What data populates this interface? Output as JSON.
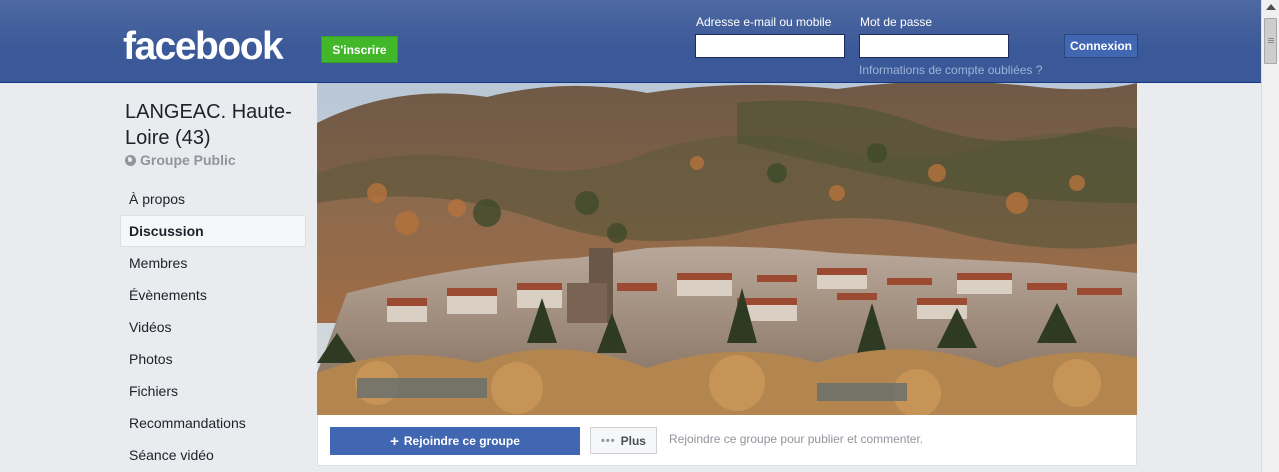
{
  "header": {
    "logo": "facebook",
    "signup_label": "S'inscrire",
    "email_label": "Adresse e-mail ou mobile",
    "password_label": "Mot de passe",
    "login_label": "Connexion",
    "forgot_label": "Informations de compte oubliées ?"
  },
  "group": {
    "title": "LANGEAC. Haute-Loire (43)",
    "type": "Groupe Public"
  },
  "sidebar": {
    "items": [
      {
        "label": "À propos"
      },
      {
        "label": "Discussion"
      },
      {
        "label": "Membres"
      },
      {
        "label": "Évènements"
      },
      {
        "label": "Vidéos"
      },
      {
        "label": "Photos"
      },
      {
        "label": "Fichiers"
      },
      {
        "label": "Recommandations"
      },
      {
        "label": "Séance vidéo"
      }
    ],
    "active": "Discussion"
  },
  "actions": {
    "join_label": "Rejoindre ce groupe",
    "more_label": "Plus",
    "hint": "Rejoindre ce groupe pour publier et commenter."
  },
  "colors": {
    "brand": "#3b5998",
    "signup": "#42b72a",
    "button": "#4267b2",
    "page_bg": "#e9ebee"
  }
}
